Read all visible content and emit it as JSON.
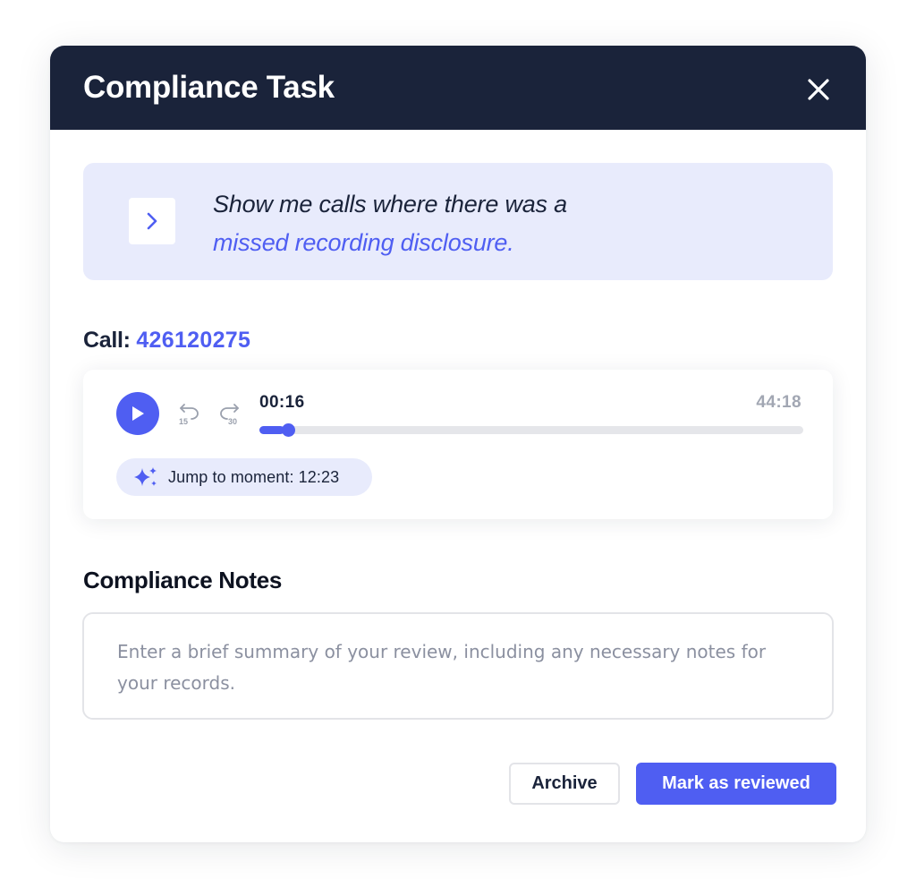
{
  "modal": {
    "title": "Compliance Task",
    "close_icon": "close-icon",
    "header_color": "#1a233a"
  },
  "prompt": {
    "icon": "chevron-right-icon",
    "text_prefix": "Show me calls where there was a",
    "text_highlight": "missed recording disclosure."
  },
  "call": {
    "label": "Call:",
    "id": "426120275"
  },
  "player": {
    "play_icon": "play-icon",
    "skip_back_icon": "rewind-15-icon",
    "skip_back_seconds": "15",
    "skip_forward_icon": "forward-30-icon",
    "skip_forward_seconds": "30",
    "current_time": "00:16",
    "total_time": "44:18",
    "progress_fraction": 0.006,
    "jump_icon": "sparkle-icon",
    "jump_label": "Jump to moment: 12:23"
  },
  "notes": {
    "title": "Compliance Notes",
    "placeholder": "Enter a brief summary of your review, including any necessary notes for your records.",
    "value": ""
  },
  "actions": {
    "archive_label": "Archive",
    "review_label": "Mark as reviewed"
  },
  "colors": {
    "accent": "#4f5ef2",
    "prompt_background": "#e8ebfc",
    "muted_text": "#a2a7b3"
  }
}
